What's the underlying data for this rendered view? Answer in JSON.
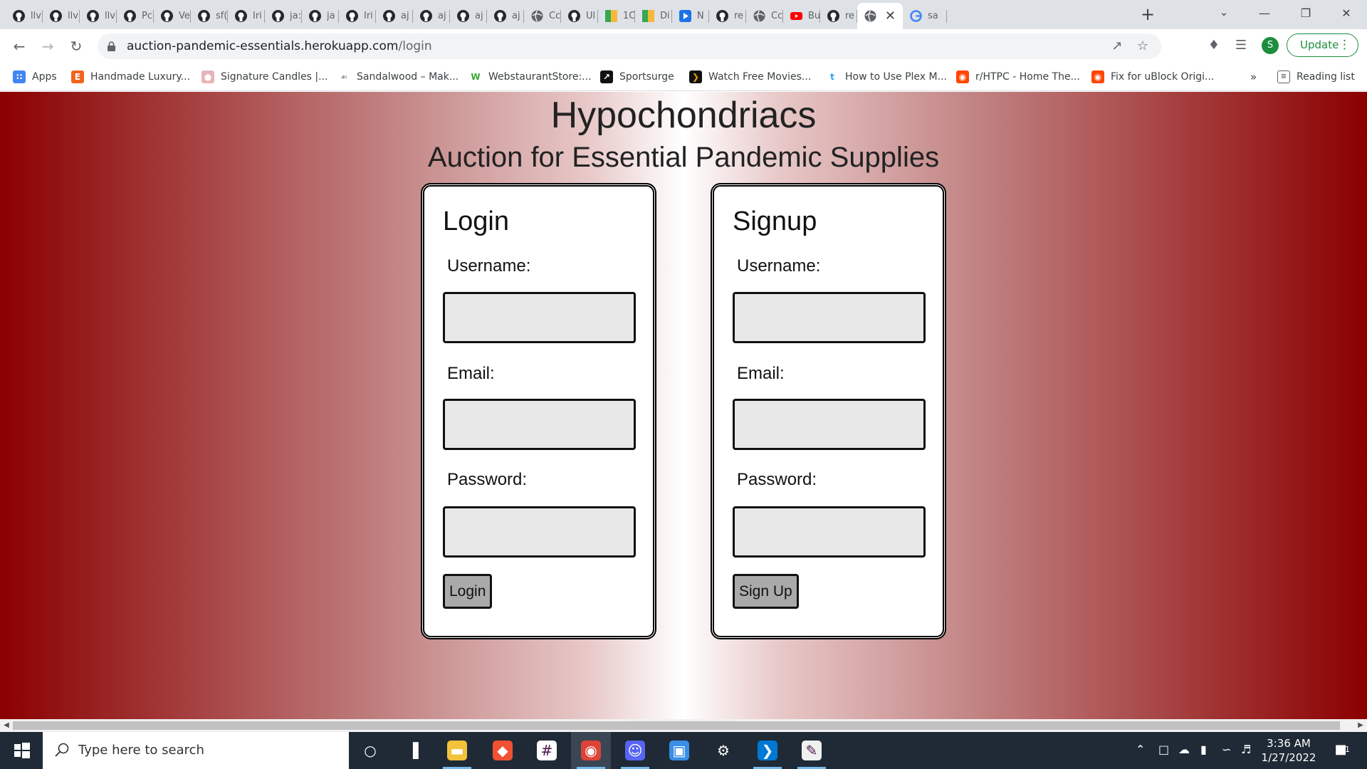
{
  "browser": {
    "tabs": [
      {
        "label": "llv",
        "icon": "github-icon"
      },
      {
        "label": "llv",
        "icon": "github-icon"
      },
      {
        "label": "llv",
        "icon": "github-icon"
      },
      {
        "label": "Pc",
        "icon": "github-icon"
      },
      {
        "label": "Ve",
        "icon": "github-icon"
      },
      {
        "label": "sf(",
        "icon": "github-icon"
      },
      {
        "label": "Iri",
        "icon": "github-icon"
      },
      {
        "label": "ja:",
        "icon": "github-icon"
      },
      {
        "label": "ja",
        "icon": "github-icon"
      },
      {
        "label": "Iri",
        "icon": "github-icon"
      },
      {
        "label": "aj",
        "icon": "github-icon"
      },
      {
        "label": "aj",
        "icon": "github-icon"
      },
      {
        "label": "aj",
        "icon": "github-icon"
      },
      {
        "label": "aj",
        "icon": "github-icon"
      },
      {
        "label": "Cc",
        "icon": "globe-icon"
      },
      {
        "label": "Ul",
        "icon": "github-icon"
      },
      {
        "label": "1C",
        "icon": "map-icon"
      },
      {
        "label": "Di",
        "icon": "map-icon"
      },
      {
        "label": "N",
        "icon": "play-icon"
      },
      {
        "label": "re",
        "icon": "github-icon"
      },
      {
        "label": "Cc",
        "icon": "globe-icon"
      },
      {
        "label": "Bu",
        "icon": "youtube-icon"
      },
      {
        "label": "re",
        "icon": "github-icon"
      },
      {
        "label": "",
        "icon": "globe-icon",
        "active": true
      },
      {
        "label": "sa",
        "icon": "google-icon"
      }
    ],
    "address": {
      "host": "auction-pandemic-essentials.herokuapp.com",
      "path": "/login"
    },
    "update_label": "Update",
    "profile_initial": "S",
    "bookmarks": [
      {
        "label": "Apps",
        "icon": "apps-grid-icon"
      },
      {
        "label": "Handmade Luxury...",
        "icon": "etsy-icon"
      },
      {
        "label": "Signature Candles |...",
        "icon": "candle-icon"
      },
      {
        "label": "Sandalwood – Mak...",
        "icon": "sandalwood-icon"
      },
      {
        "label": "WebstaurantStore:...",
        "icon": "webstaurant-icon"
      },
      {
        "label": "Sportsurge",
        "icon": "sportsurge-icon"
      },
      {
        "label": "Watch Free Movies...",
        "icon": "plex-icon"
      },
      {
        "label": "How to Use Plex M...",
        "icon": "tumblr-icon"
      },
      {
        "label": "r/HTPC - Home The...",
        "icon": "reddit-icon"
      },
      {
        "label": "Fix for uBlock Origi...",
        "icon": "reddit-icon"
      }
    ],
    "bookmarks_overflow": "»",
    "reading_list_label": "Reading list"
  },
  "page": {
    "title": "Hypochondriacs",
    "subtitle": "Auction for Essential Pandemic Supplies",
    "login": {
      "heading": "Login",
      "username_label": "Username:",
      "email_label": "Email:",
      "password_label": "Password:",
      "submit_label": "Login"
    },
    "signup": {
      "heading": "Signup",
      "username_label": "Username:",
      "email_label": "Email:",
      "password_label": "Password:",
      "submit_label": "Sign Up"
    },
    "colors": {
      "gradient_edge": "#8b0000",
      "gradient_center": "#ffffff",
      "input_fill": "#e8e8e8",
      "button_fill": "#aaaaaa"
    }
  },
  "taskbar": {
    "search_placeholder": "Type here to search",
    "apps": [
      "cortana-icon",
      "task-view-icon",
      "file-explorer-icon",
      "git-icon",
      "slack-icon",
      "chrome-icon",
      "discord-icon",
      "control-panel-icon",
      "settings-icon",
      "vscode-icon",
      "paint-icon"
    ],
    "time": "3:36 AM",
    "date": "1/27/2022",
    "notification_count": "1"
  }
}
